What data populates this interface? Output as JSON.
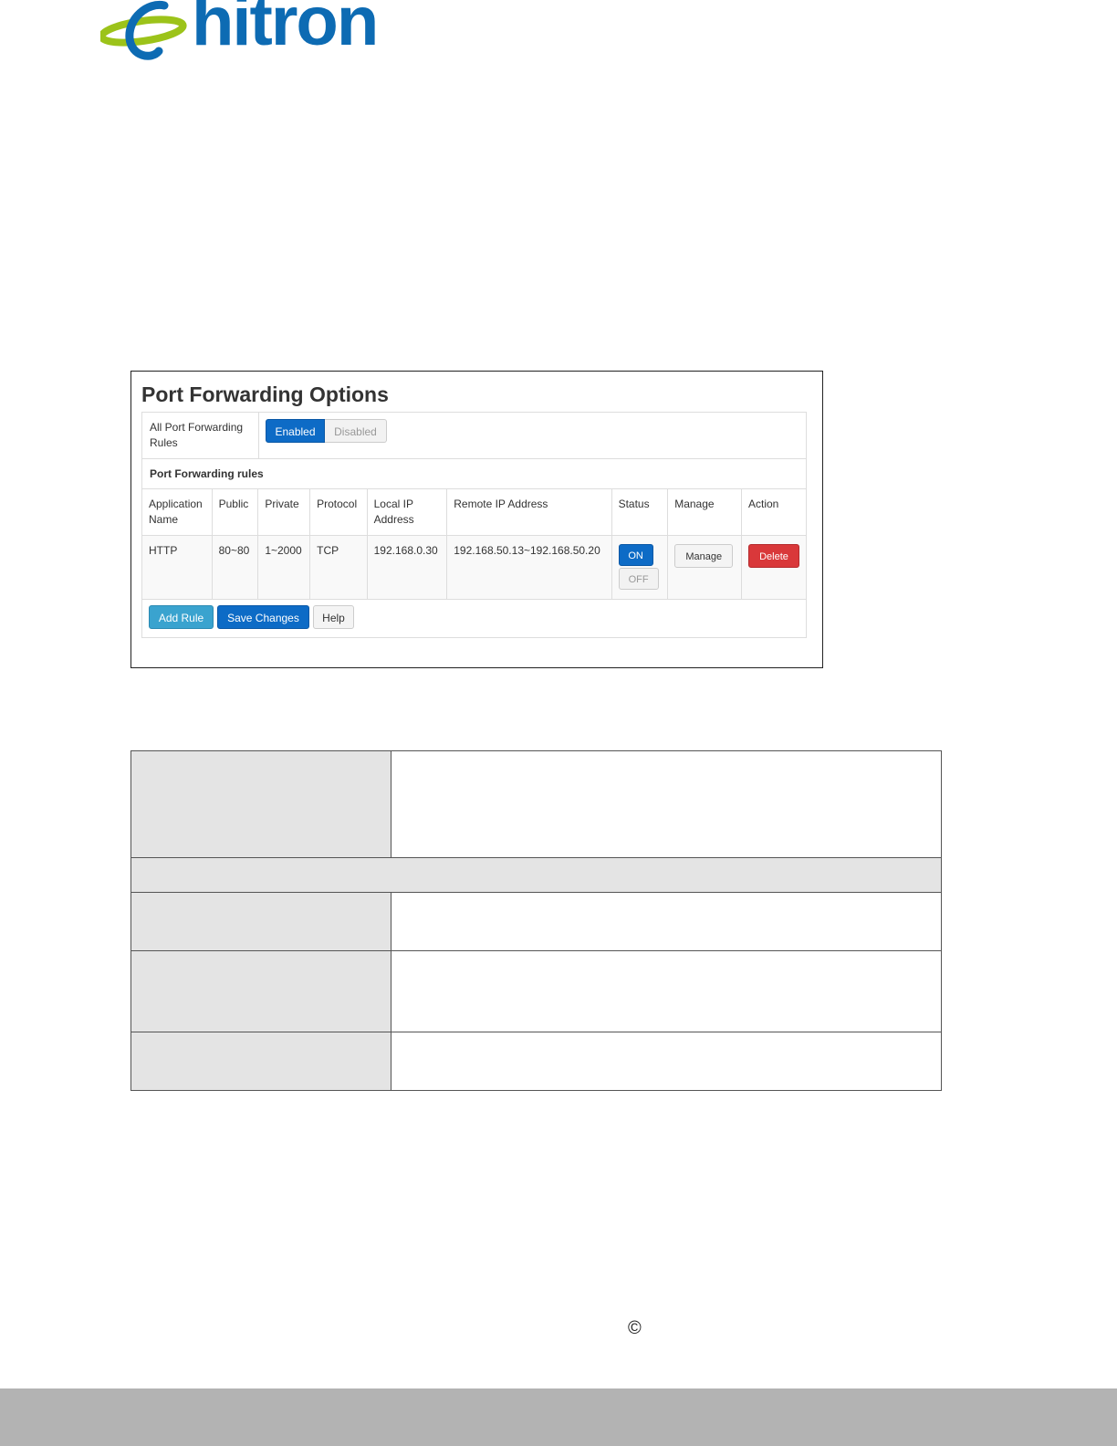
{
  "brand": {
    "name": "hitron",
    "color": "#0d6bb3",
    "accent": "#9cc31a"
  },
  "screenshot": {
    "title": "Port Forwarding Options",
    "all_rules_label": "All Port Forwarding Rules",
    "toggle": {
      "enabled": "Enabled",
      "disabled": "Disabled",
      "selected": "Enabled"
    },
    "section_label": "Port Forwarding rules",
    "columns": [
      "Application Name",
      "Public",
      "Private",
      "Protocol",
      "Local IP Address",
      "Remote IP Address",
      "Status",
      "Manage",
      "Action"
    ],
    "rows": [
      {
        "app": "HTTP",
        "public": "80~80",
        "private": "1~2000",
        "protocol": "TCP",
        "local_ip": "192.168.0.30",
        "remote_ip": "192.168.50.13~192.168.50.20",
        "status_on": "ON",
        "status_off": "OFF",
        "manage": "Manage",
        "action": "Delete"
      }
    ],
    "buttons": {
      "add_rule": "Add Rule",
      "save_changes": "Save Changes",
      "help": "Help"
    }
  },
  "footer": {
    "copyright_symbol": "©"
  }
}
